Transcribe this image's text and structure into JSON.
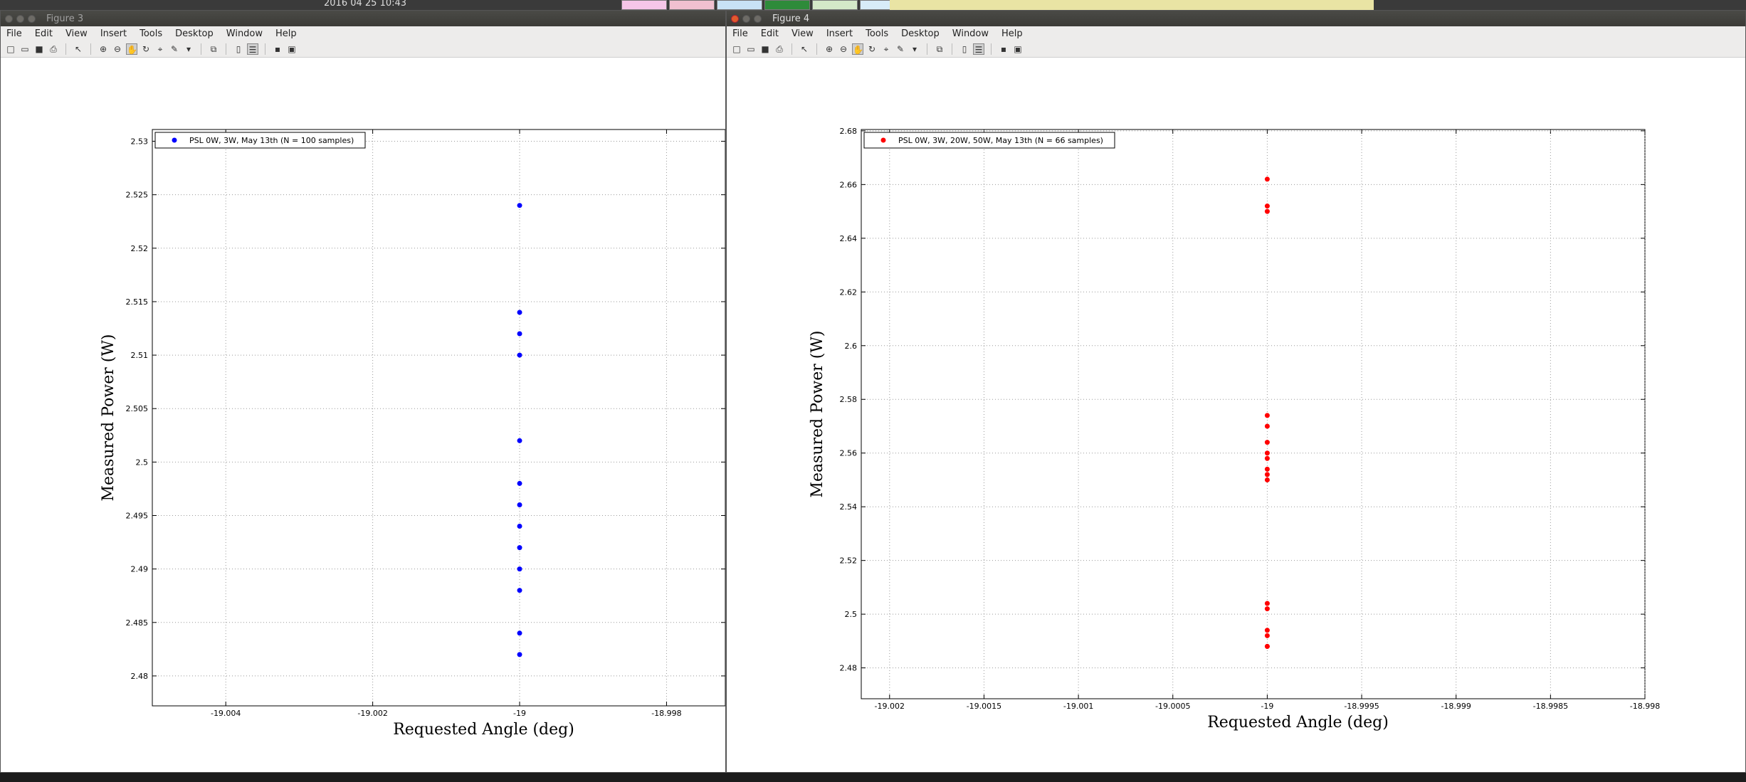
{
  "desktop": {
    "clock": "2016 04 25 10:43"
  },
  "menu": [
    "File",
    "Edit",
    "View",
    "Insert",
    "Tools",
    "Desktop",
    "Window",
    "Help"
  ],
  "fig3": {
    "title": "Figure 3"
  },
  "fig4": {
    "title": "Figure 4"
  },
  "chart_data": [
    {
      "type": "scatter",
      "xlabel": "Requested Angle (deg)",
      "ylabel": "Measured Power (W)",
      "xlim": [
        -19.005,
        -18.9972
      ],
      "ylim": [
        2.4772,
        2.5311
      ],
      "xticks": [
        -19.004,
        -19.002,
        -19,
        -18.998
      ],
      "xtick_labels": [
        "-19.004",
        "-19.002",
        "-19",
        "-18.998"
      ],
      "yticks": [
        2.48,
        2.485,
        2.49,
        2.495,
        2.5,
        2.505,
        2.51,
        2.515,
        2.52,
        2.525,
        2.53
      ],
      "ytick_labels": [
        "2.48",
        "2.485",
        "2.49",
        "2.495",
        "2.5",
        "2.505",
        "2.51",
        "2.515",
        "2.52",
        "2.525",
        "2.53"
      ],
      "grid": true,
      "legend_position": "top-left",
      "series": [
        {
          "name": "PSL 0W, 3W, May 13th (N = 100 samples)",
          "color": "#0000ff",
          "x": [
            -19,
            -19,
            -19,
            -19,
            -19,
            -19,
            -19,
            -19,
            -19,
            -19,
            -19,
            -19,
            -19
          ],
          "y": [
            2.524,
            2.514,
            2.512,
            2.51,
            2.502,
            2.498,
            2.496,
            2.494,
            2.492,
            2.49,
            2.488,
            2.484,
            2.482
          ]
        }
      ]
    },
    {
      "type": "scatter",
      "xlabel": "Requested Angle (deg)",
      "ylabel": "Measured Power (W)",
      "xlim": [
        -19.00215,
        -18.998
      ],
      "ylim": [
        2.4685,
        2.6805
      ],
      "xticks": [
        -19.002,
        -19.0015,
        -19.001,
        -19.0005,
        -19,
        -18.9995,
        -18.999,
        -18.9985,
        -18.998
      ],
      "xtick_labels": [
        "-19.002",
        "-19.0015",
        "-19.001",
        "-19.0005",
        "-19",
        "-18.9995",
        "-18.999",
        "-18.9985",
        "-18.998"
      ],
      "yticks": [
        2.48,
        2.5,
        2.52,
        2.54,
        2.56,
        2.58,
        2.6,
        2.62,
        2.64,
        2.66,
        2.68
      ],
      "ytick_labels": [
        "2.48",
        "2.5",
        "2.52",
        "2.54",
        "2.56",
        "2.58",
        "2.6",
        "2.62",
        "2.64",
        "2.66",
        "2.68"
      ],
      "grid": true,
      "legend_position": "top-left",
      "series": [
        {
          "name": "PSL 0W, 3W, 20W, 50W, May 13th (N = 66 samples)",
          "color": "#ff0000",
          "x": [
            -19,
            -19,
            -19,
            -19,
            -19,
            -19,
            -19,
            -19,
            -19,
            -19,
            -19,
            -19,
            -19,
            -19,
            -19,
            -19,
            -19
          ],
          "y": [
            2.662,
            2.652,
            2.65,
            2.574,
            2.57,
            2.564,
            2.56,
            2.558,
            2.554,
            2.552,
            2.55,
            2.504,
            2.502,
            2.494,
            2.492,
            2.488,
            2.488
          ]
        }
      ]
    }
  ]
}
